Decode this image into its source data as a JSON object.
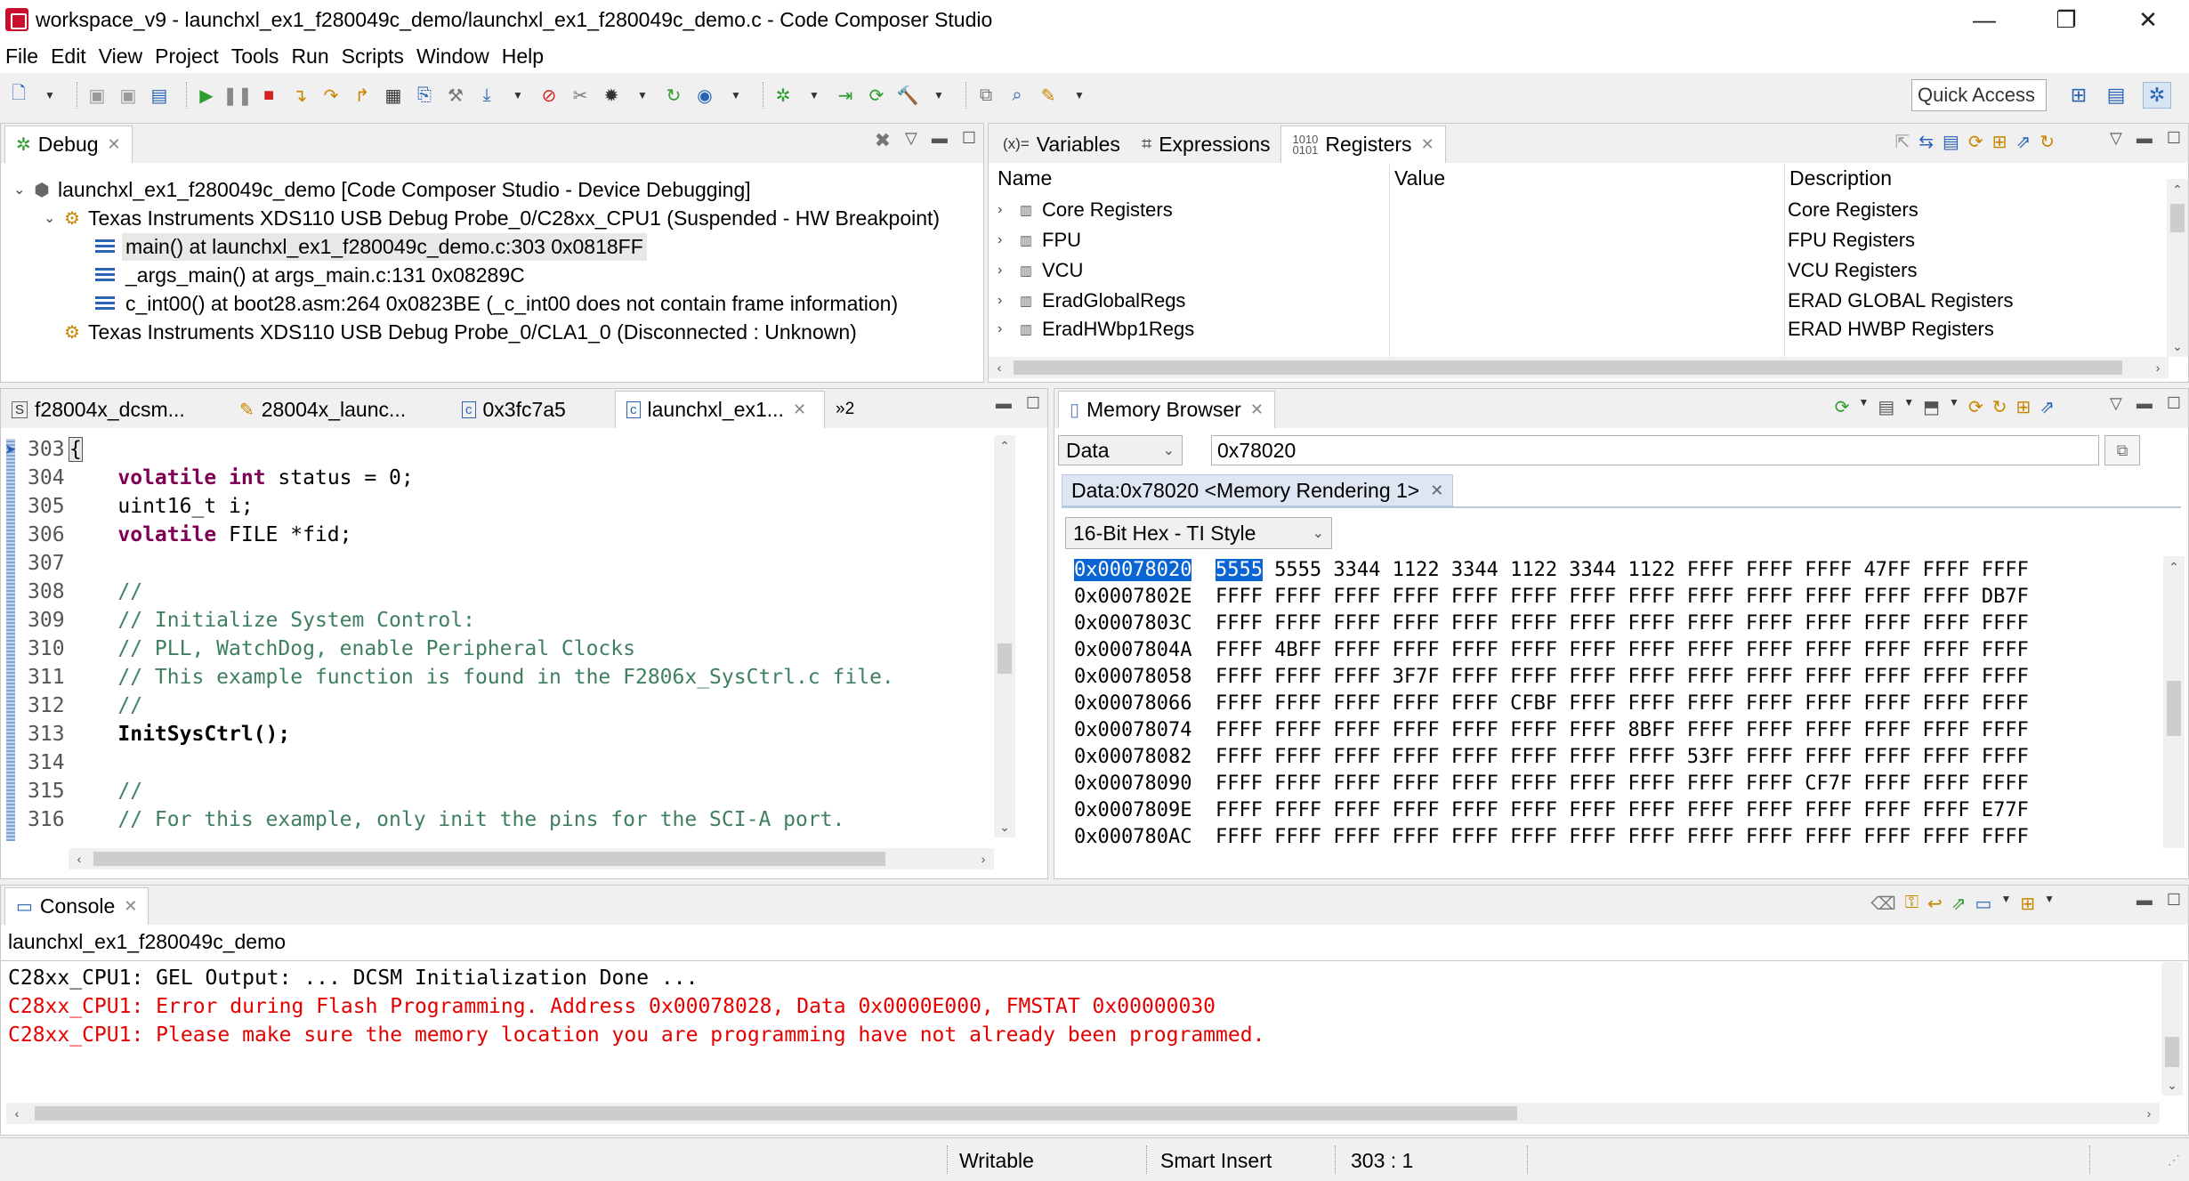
{
  "window": {
    "title": "workspace_v9 - launchxl_ex1_f280049c_demo/launchxl_ex1_f280049c_demo.c - Code Composer Studio",
    "minimize": "—",
    "maximize": "❐",
    "close": "✕"
  },
  "menu": [
    "File",
    "Edit",
    "View",
    "Project",
    "Tools",
    "Run",
    "Scripts",
    "Window",
    "Help"
  ],
  "toolbar": {
    "quick_access": "Quick Access"
  },
  "debug_view": {
    "tab_label": "Debug",
    "tree": [
      {
        "label": "launchxl_ex1_f280049c_demo [Code Composer Studio - Device Debugging]"
      },
      {
        "label": "Texas Instruments XDS110 USB Debug Probe_0/C28xx_CPU1 (Suspended - HW Breakpoint)"
      },
      {
        "label": "main() at launchxl_ex1_f280049c_demo.c:303 0x0818FF"
      },
      {
        "label": "_args_main() at args_main.c:131 0x08289C"
      },
      {
        "label": "c_int00() at boot28.asm:264 0x0823BE  (_c_int00 does not contain frame information)"
      },
      {
        "label": "Texas Instruments XDS110 USB Debug Probe_0/CLA1_0 (Disconnected : Unknown)"
      }
    ]
  },
  "registers_view": {
    "tabs": [
      "Variables",
      "Expressions",
      "Registers"
    ],
    "columns": [
      "Name",
      "Value",
      "Description"
    ],
    "rows": [
      {
        "name": "Core Registers",
        "value": "",
        "description": "Core Registers"
      },
      {
        "name": "FPU",
        "value": "",
        "description": "FPU Registers"
      },
      {
        "name": "VCU",
        "value": "",
        "description": "VCU Registers"
      },
      {
        "name": "EradGlobalRegs",
        "value": "",
        "description": "ERAD GLOBAL Registers"
      },
      {
        "name": "EradHWbp1Regs",
        "value": "",
        "description": "ERAD HWBP Registers"
      }
    ]
  },
  "editor": {
    "tabs": [
      "f28004x_dcsm...",
      "28004x_launc...",
      "0x3fc7a5",
      "launchxl_ex1...",
      "»2"
    ],
    "lines": [
      {
        "no": "303",
        "text": "{"
      },
      {
        "no": "304",
        "text": "    volatile int status = 0;"
      },
      {
        "no": "305",
        "text": "    uint16_t i;"
      },
      {
        "no": "306",
        "text": "    volatile FILE *fid;"
      },
      {
        "no": "307",
        "text": ""
      },
      {
        "no": "308",
        "text": "    //"
      },
      {
        "no": "309",
        "text": "    // Initialize System Control:"
      },
      {
        "no": "310",
        "text": "    // PLL, WatchDog, enable Peripheral Clocks"
      },
      {
        "no": "311",
        "text": "    // This example function is found in the F2806x_SysCtrl.c file."
      },
      {
        "no": "312",
        "text": "    //"
      },
      {
        "no": "313",
        "text": "    InitSysCtrl();"
      },
      {
        "no": "314",
        "text": ""
      },
      {
        "no": "315",
        "text": "    //"
      },
      {
        "no": "316",
        "text": "    // For this example, only init the pins for the SCI-A port."
      }
    ]
  },
  "memory_browser": {
    "tab_label": "Memory Browser",
    "page": "Data",
    "address": "0x78020",
    "rendering_tab": "Data:0x78020 <Memory Rendering 1>",
    "format": "16-Bit Hex - TI Style",
    "rows": [
      {
        "addr": "0x00078020",
        "words": "5555 5555 3344 1122 3344 1122 3344 1122 FFFF FFFF FFFF 47FF FFFF FFFF"
      },
      {
        "addr": "0x0007802E",
        "words": "FFFF FFFF FFFF FFFF FFFF FFFF FFFF FFFF FFFF FFFF FFFF FFFF FFFF DB7F"
      },
      {
        "addr": "0x0007803C",
        "words": "FFFF FFFF FFFF FFFF FFFF FFFF FFFF FFFF FFFF FFFF FFFF FFFF FFFF FFFF"
      },
      {
        "addr": "0x0007804A",
        "words": "FFFF 4BFF FFFF FFFF FFFF FFFF FFFF FFFF FFFF FFFF FFFF FFFF FFFF FFFF"
      },
      {
        "addr": "0x00078058",
        "words": "FFFF FFFF FFFF 3F7F FFFF FFFF FFFF FFFF FFFF FFFF FFFF FFFF FFFF FFFF"
      },
      {
        "addr": "0x00078066",
        "words": "FFFF FFFF FFFF FFFF FFFF CFBF FFFF FFFF FFFF FFFF FFFF FFFF FFFF FFFF"
      },
      {
        "addr": "0x00078074",
        "words": "FFFF FFFF FFFF FFFF FFFF FFFF FFFF 8BFF FFFF FFFF FFFF FFFF FFFF FFFF"
      },
      {
        "addr": "0x00078082",
        "words": "FFFF FFFF FFFF FFFF FFFF FFFF FFFF FFFF 53FF FFFF FFFF FFFF FFFF FFFF"
      },
      {
        "addr": "0x00078090",
        "words": "FFFF FFFF FFFF FFFF FFFF FFFF FFFF FFFF FFFF FFFF CF7F FFFF FFFF FFFF"
      },
      {
        "addr": "0x0007809E",
        "words": "FFFF FFFF FFFF FFFF FFFF FFFF FFFF FFFF FFFF FFFF FFFF FFFF FFFF E77F"
      },
      {
        "addr": "0x000780AC",
        "words": "FFFF FFFF FFFF FFFF FFFF FFFF FFFF FFFF FFFF FFFF FFFF FFFF FFFF FFFF"
      }
    ]
  },
  "console": {
    "tab_label": "Console",
    "project": "launchxl_ex1_f280049c_demo",
    "lines": [
      {
        "text": "C28xx_CPU1: GEL Output: ... DCSM Initialization Done ...",
        "error": false
      },
      {
        "text": "C28xx_CPU1: Error during Flash Programming. Address 0x00078028, Data 0x0000E000, FMSTAT 0x00000030",
        "error": true
      },
      {
        "text": "C28xx_CPU1: Please make sure the memory location you are programming have not already been programmed.",
        "error": true
      }
    ]
  },
  "status_bar": {
    "writable": "Writable",
    "insert_mode": "Smart Insert",
    "position": "303 : 1"
  }
}
